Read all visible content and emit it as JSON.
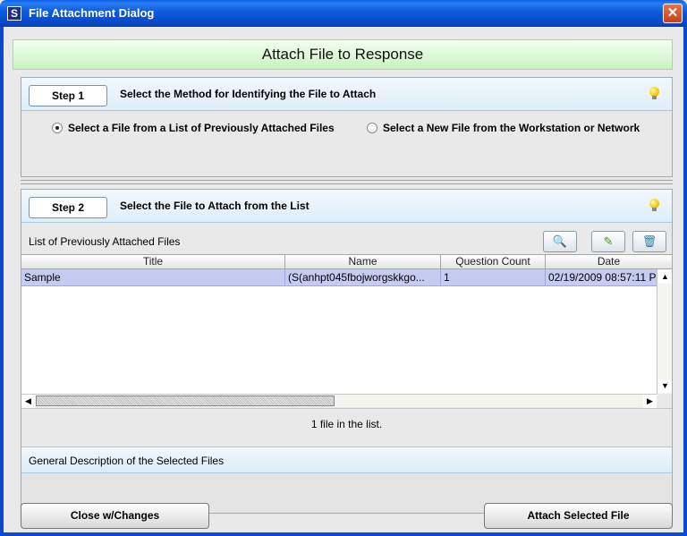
{
  "window": {
    "title": "File Attachment Dialog",
    "app_icon": "S",
    "close_glyph": "✕"
  },
  "banner": {
    "title": "Attach File to Response"
  },
  "step1": {
    "step_label": "Step 1",
    "title": "Select the Method for Identifying the File to Attach",
    "options": [
      {
        "label": "Select a File from a List of Previously Attached Files",
        "selected": true
      },
      {
        "label": "Select a New File from the Workstation or Network",
        "selected": false
      }
    ]
  },
  "step2": {
    "step_label": "Step 2",
    "title": "Select the File to Attach from the List",
    "list_label": "List of Previously Attached Files",
    "tool_icons": [
      "magnifier-icon",
      "pencil-icon",
      "delete-icon"
    ],
    "columns": [
      "Title",
      "Name",
      "Question Count",
      "Date"
    ],
    "rows": [
      {
        "title": "Sample",
        "name": "(S(anhpt045fbojworgskkgo...",
        "question_count": "1",
        "date": "02/19/2009 08:57:11 P"
      }
    ],
    "file_count": "1 file in the list.",
    "description_label": "General Description of the Selected Files"
  },
  "buttons": {
    "close": "Close w/Changes",
    "attach": "Attach Selected File"
  }
}
